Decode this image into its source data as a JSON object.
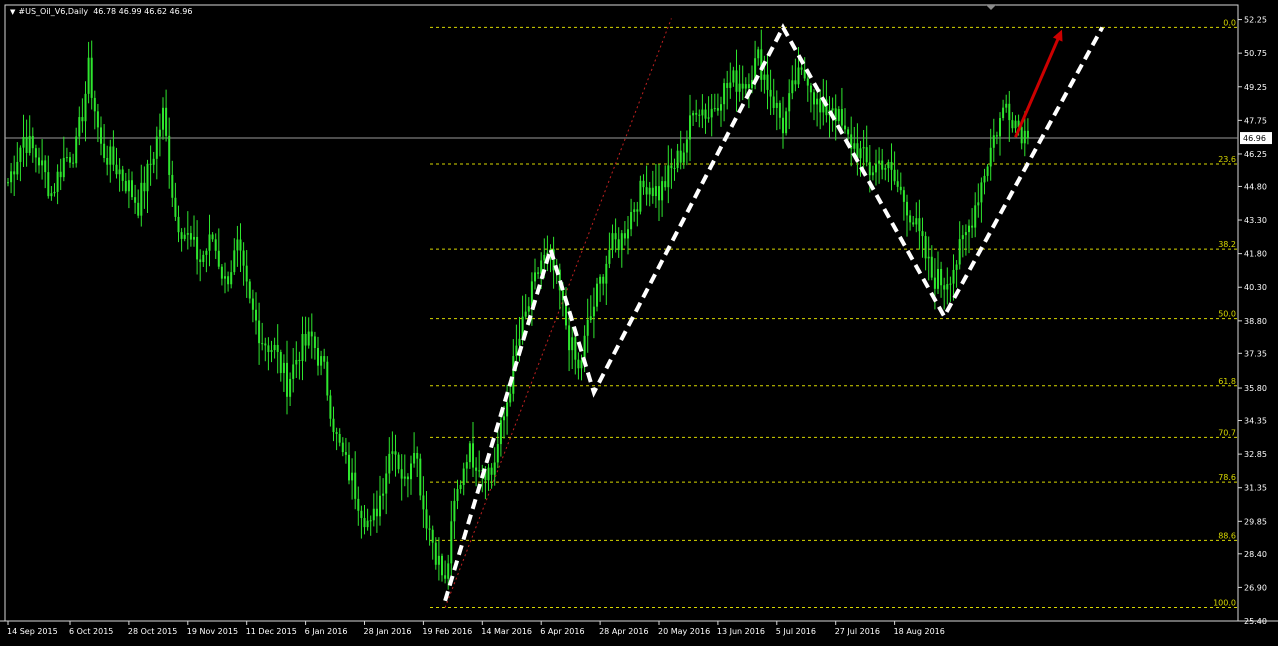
{
  "header": {
    "symbol": "#US_Oil_V6,Daily",
    "ohlc": "46.78 46.99 46.62 46.96"
  },
  "colors": {
    "background": "#000000",
    "candle": "#2ee62e",
    "axis": "#d8d8d8",
    "text": "#ffffff",
    "fib": "#d8d800",
    "zigzag": "#ffffff",
    "arrow": "#cc0000",
    "trendline": "#c02020",
    "price_line": "#9a9a9a"
  },
  "chart_data": {
    "type": "candlestick",
    "ylim": [
      25.4,
      52.9
    ],
    "y_ticks": [
      "52.25",
      "50.75",
      "49.25",
      "47.75",
      "46.25",
      "44.80",
      "43.30",
      "41.80",
      "40.30",
      "38.80",
      "37.35",
      "35.80",
      "34.35",
      "32.85",
      "31.35",
      "29.85",
      "28.40",
      "26.90",
      "25.40"
    ],
    "x_labels": [
      "14 Sep 2015",
      "6 Oct 2015",
      "28 Oct 2015",
      "19 Nov 2015",
      "11 Dec 2015",
      "6 Jan 2016",
      "28 Jan 2016",
      "19 Feb 2016",
      "14 Mar 2016",
      "6 Apr 2016",
      "28 Apr 2016",
      "20 May 2016",
      "13 Jun 2016",
      "5 Jul 2016",
      "27 Jul 2016",
      "18 Aug 2016"
    ],
    "current_price": "46.96",
    "anchors": [
      [
        0,
        45.0
      ],
      [
        5,
        47.0
      ],
      [
        10,
        46.0
      ],
      [
        14,
        44.5
      ],
      [
        18,
        46.0
      ],
      [
        22,
        46.5
      ],
      [
        25,
        49.0
      ],
      [
        26,
        50.0
      ],
      [
        30,
        46.5
      ],
      [
        36,
        45.5
      ],
      [
        42,
        44.0
      ],
      [
        46,
        45.8
      ],
      [
        50,
        48.0
      ],
      [
        54,
        43.5
      ],
      [
        58,
        42.5
      ],
      [
        62,
        41.5
      ],
      [
        66,
        42.5
      ],
      [
        70,
        40.5
      ],
      [
        74,
        42.0
      ],
      [
        78,
        39.5
      ],
      [
        82,
        38.0
      ],
      [
        86,
        37.5
      ],
      [
        90,
        36.0
      ],
      [
        94,
        37.5
      ],
      [
        98,
        38.0
      ],
      [
        102,
        36.5
      ],
      [
        106,
        33.5
      ],
      [
        110,
        32.0
      ],
      [
        114,
        30.5
      ],
      [
        117,
        29.5
      ],
      [
        120,
        31.0
      ],
      [
        124,
        33.5
      ],
      [
        128,
        31.5
      ],
      [
        131,
        33.5
      ],
      [
        134,
        30.5
      ],
      [
        138,
        28.5
      ],
      [
        141,
        27.0
      ],
      [
        144,
        30.5
      ],
      [
        148,
        33.0
      ],
      [
        152,
        32.5
      ],
      [
        156,
        32.0
      ],
      [
        160,
        34.5
      ],
      [
        164,
        37.5
      ],
      [
        168,
        39.5
      ],
      [
        172,
        41.5
      ],
      [
        175,
        41.5
      ],
      [
        178,
        40.0
      ],
      [
        181,
        38.0
      ],
      [
        184,
        36.5
      ],
      [
        187,
        38.5
      ],
      [
        190,
        40.0
      ],
      [
        194,
        42.0
      ],
      [
        198,
        42.5
      ],
      [
        202,
        44.0
      ],
      [
        206,
        45.0
      ],
      [
        210,
        44.5
      ],
      [
        214,
        45.5
      ],
      [
        218,
        46.5
      ],
      [
        222,
        48.5
      ],
      [
        226,
        48.0
      ],
      [
        230,
        49.0
      ],
      [
        234,
        49.5
      ],
      [
        238,
        49.5
      ],
      [
        242,
        50.5
      ],
      [
        246,
        49.0
      ],
      [
        250,
        47.5
      ],
      [
        254,
        49.5
      ],
      [
        258,
        49.8
      ],
      [
        262,
        48.0
      ],
      [
        266,
        48.5
      ],
      [
        270,
        47.0
      ],
      [
        274,
        46.5
      ],
      [
        278,
        45.5
      ],
      [
        282,
        46.0
      ],
      [
        286,
        45.0
      ],
      [
        290,
        44.0
      ],
      [
        294,
        42.5
      ],
      [
        298,
        40.8
      ],
      [
        302,
        40.5
      ],
      [
        306,
        41.5
      ],
      [
        310,
        43.0
      ],
      [
        314,
        45.0
      ],
      [
        318,
        47.0
      ],
      [
        322,
        48.5
      ],
      [
        326,
        47.5
      ],
      [
        329,
        46.96
      ]
    ],
    "fib_levels": [
      {
        "label": "0.0",
        "price": 51.9
      },
      {
        "label": "23.6",
        "price": 45.8
      },
      {
        "label": "38.2",
        "price": 42.0
      },
      {
        "label": "50.0",
        "price": 38.9
      },
      {
        "label": "61.8",
        "price": 35.9
      },
      {
        "label": "70.7",
        "price": 33.6
      },
      {
        "label": "78.6",
        "price": 31.6
      },
      {
        "label": "88.6",
        "price": 29.0
      },
      {
        "label": "100.0",
        "price": 26.0
      }
    ],
    "zigzag": [
      [
        141,
        26.3
      ],
      [
        175,
        42.0
      ],
      [
        189,
        35.6
      ],
      [
        250,
        51.9
      ],
      [
        302,
        39.0
      ],
      [
        353,
        51.9
      ]
    ],
    "trendline": [
      [
        141,
        26.0
      ],
      [
        214,
        52.3
      ]
    ],
    "arrow": [
      [
        325,
        47.0
      ],
      [
        340,
        51.8
      ]
    ],
    "x_label_bars": [
      0,
      20,
      39,
      58,
      77,
      96,
      115,
      134,
      153,
      172,
      191,
      210,
      229,
      248,
      267,
      286
    ]
  }
}
